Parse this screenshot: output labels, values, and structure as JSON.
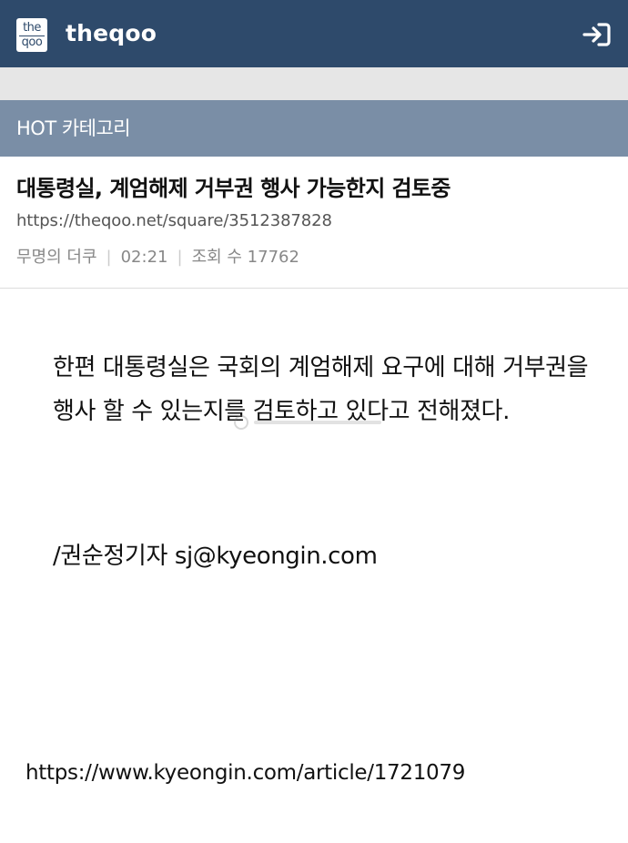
{
  "header": {
    "logo_top": "the",
    "logo_bottom": "qoo",
    "brand": "theqoo",
    "login_icon": "login-icon"
  },
  "category": {
    "label": "HOT 카테고리"
  },
  "post": {
    "title": "대통령실, 계엄해제 거부권 행사 가능한지 검토중",
    "url": "https://theqoo.net/square/3512387828",
    "author": "무명의 더쿠",
    "time": "02:21",
    "views_label": "조회 수 17762"
  },
  "content": {
    "paragraph": "한편 대통령실은 국회의 계엄해제 요구에 대해 거부권을 행사 할 수 있는지를 검토하고 있다고 전해졌다.",
    "byline": "/권순정기자 sj@kyeongin.com",
    "source_link": "https://www.kyeongin.com/article/1721079"
  },
  "colors": {
    "header_bg": "#2e4a6b",
    "category_bg": "#7a8ea6",
    "strip_bg": "#e6e6e6"
  }
}
